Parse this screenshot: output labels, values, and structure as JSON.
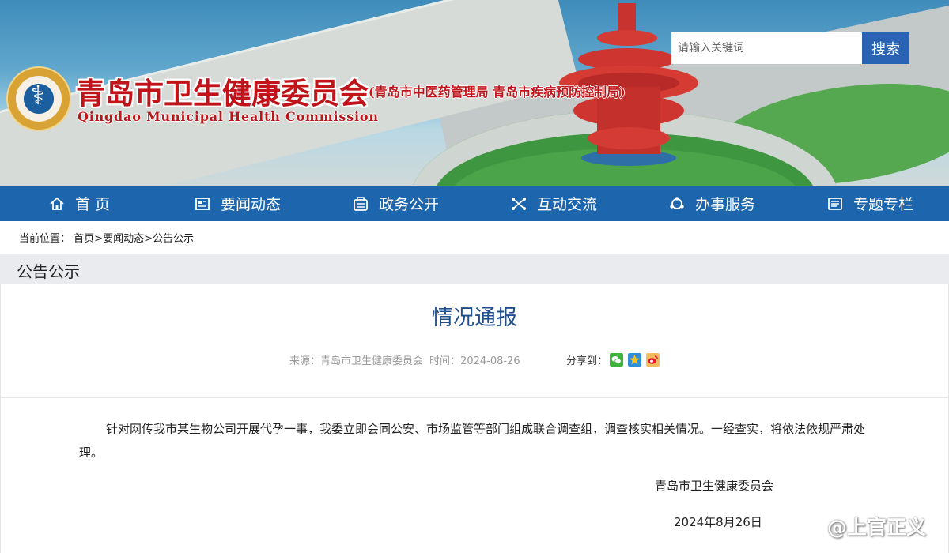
{
  "header": {
    "title_cn": "青岛市卫生健康委员会",
    "subtitle_cn": "(青岛市中医药管理局 青岛市疾病预防控制局)",
    "title_en": "Qingdao Municipal Health Commission",
    "search": {
      "placeholder": "请输入关键词",
      "button_label": "搜索"
    }
  },
  "nav": {
    "items": [
      {
        "label": "首 页",
        "icon": "home-icon"
      },
      {
        "label": "要闻动态",
        "icon": "news-icon"
      },
      {
        "label": "政务公开",
        "icon": "government-icon"
      },
      {
        "label": "互动交流",
        "icon": "interaction-icon"
      },
      {
        "label": "办事服务",
        "icon": "service-icon"
      },
      {
        "label": "专题专栏",
        "icon": "topic-icon"
      }
    ],
    "background": "#1d66ae"
  },
  "breadcrumb": {
    "prefix": "当前位置：",
    "items": [
      "首页",
      "要闻动态",
      "公告公示"
    ],
    "separator": ">"
  },
  "section": {
    "title": "公告公示"
  },
  "article": {
    "title": "情况通报",
    "source_label": "来源：",
    "source": "青岛市卫生健康委员会",
    "time_label": "时间：",
    "time": "2024-08-26",
    "share_label": "分享到：",
    "share_icons": [
      "wechat-icon",
      "qzone-icon",
      "weibo-icon"
    ],
    "body": "针对网传我市某生物公司开展代孕一事，我委立即会同公安、市场监管等部门组成联合调查组，调查核实相关情况。一经查实，将依法依规严肃处理。",
    "signature": "青岛市卫生健康委员会",
    "date": "2024年8月26日"
  },
  "watermark": {
    "text": "@上官正义"
  },
  "colors": {
    "accent": "#1d66ae",
    "title_red": "#c0141a",
    "article_title": "#1f4f8f",
    "search_button": "#2a63b4"
  }
}
